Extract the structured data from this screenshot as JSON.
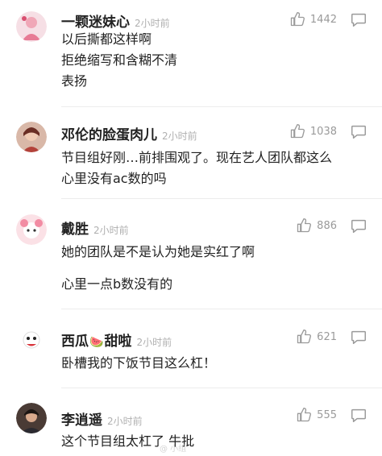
{
  "comments": [
    {
      "name": "一颗迷妹心",
      "emoji": "",
      "name_suffix": "",
      "time": "2小时前",
      "likes": "1442",
      "lines": [
        "以后撕都这样啊",
        "拒绝缩写和含糊不清",
        "表扬"
      ],
      "avatar_color": "#f2c9d2"
    },
    {
      "name": "邓伦的脸蛋肉儿",
      "emoji": "",
      "name_suffix": "",
      "time": "2小时前",
      "likes": "1038",
      "lines": [
        "节目组好刚…前排围观了。现在艺人团队都这么",
        "心里没有ac数的吗"
      ],
      "avatar_color": "#8a4a3a"
    },
    {
      "name": "戴胜",
      "emoji": "",
      "name_suffix": "",
      "time": "2小时前",
      "likes": "886",
      "lines": [
        "她的团队是不是认为她是实红了啊",
        "",
        "心里一点b数没有的"
      ],
      "avatar_color": "#f3b7c3"
    },
    {
      "name": "西瓜",
      "emoji": "🍉",
      "name_suffix": "甜啦",
      "time": "2小时前",
      "likes": "621",
      "lines": [
        "卧槽我的下饭节目这么杠！"
      ],
      "avatar_color": "#e9e9e9"
    },
    {
      "name": "李逍遥",
      "emoji": "",
      "name_suffix": "",
      "time": "2小时前",
      "likes": "555",
      "lines": [
        "这个节目组太杠了 牛批"
      ],
      "avatar_color": "#4a3b35"
    }
  ],
  "watermark": "@ 小组",
  "colors": {
    "text": "#222222",
    "meta": "#b0b0b0",
    "icon": "#9a9a9a",
    "divider": "#ececec"
  }
}
